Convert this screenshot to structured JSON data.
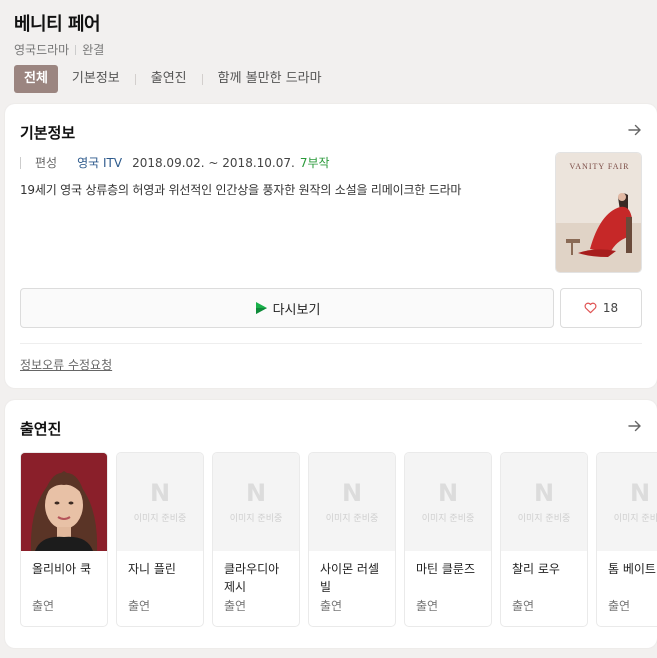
{
  "header": {
    "title": "베니티 페어",
    "genre": "영국드라마",
    "status": "완결"
  },
  "tabs": [
    {
      "label": "전체",
      "active": true
    },
    {
      "label": "기본정보",
      "active": false
    },
    {
      "label": "출연진",
      "active": false
    },
    {
      "label": "함께 볼만한 드라마",
      "active": false
    }
  ],
  "basic": {
    "heading": "기본정보",
    "info_label": "편성",
    "channel": "영국 ITV",
    "dates": "2018.09.02. ~ 2018.10.07.",
    "episodes": "7부작",
    "description": "19세기 영국 상류층의 허영과 위선적인 인간상을 풍자한 원작의 소설을 리메이크한 드라마",
    "poster_title": "VANITY FAIR",
    "replay_label": "다시보기",
    "like_count": "18",
    "report_label": "정보오류 수정요청"
  },
  "cast": {
    "heading": "출연진",
    "no_image_logo": "N",
    "no_image_text": "이미지 준비중",
    "members": [
      {
        "name": "올리비아 쿡",
        "role": "출연",
        "has_photo": true
      },
      {
        "name": "자니 플린",
        "role": "출연",
        "has_photo": false
      },
      {
        "name": "클라우디아 제시",
        "role": "출연",
        "has_photo": false
      },
      {
        "name": "사이몬 러셀 빌",
        "role": "출연",
        "has_photo": false
      },
      {
        "name": "마틴 클룬즈",
        "role": "출연",
        "has_photo": false
      },
      {
        "name": "찰리 로우",
        "role": "출연",
        "has_photo": false
      },
      {
        "name": "톰 베이트먼",
        "role": "출연",
        "has_photo": false
      }
    ]
  },
  "colors": {
    "active_tab": "#9b8580",
    "channel_link": "#2d5a8c",
    "episodes": "#2a9a3a",
    "heart": "#e05555"
  },
  "icons": {
    "arrow": "arrow-right-icon",
    "play": "play-icon",
    "heart": "heart-icon"
  }
}
